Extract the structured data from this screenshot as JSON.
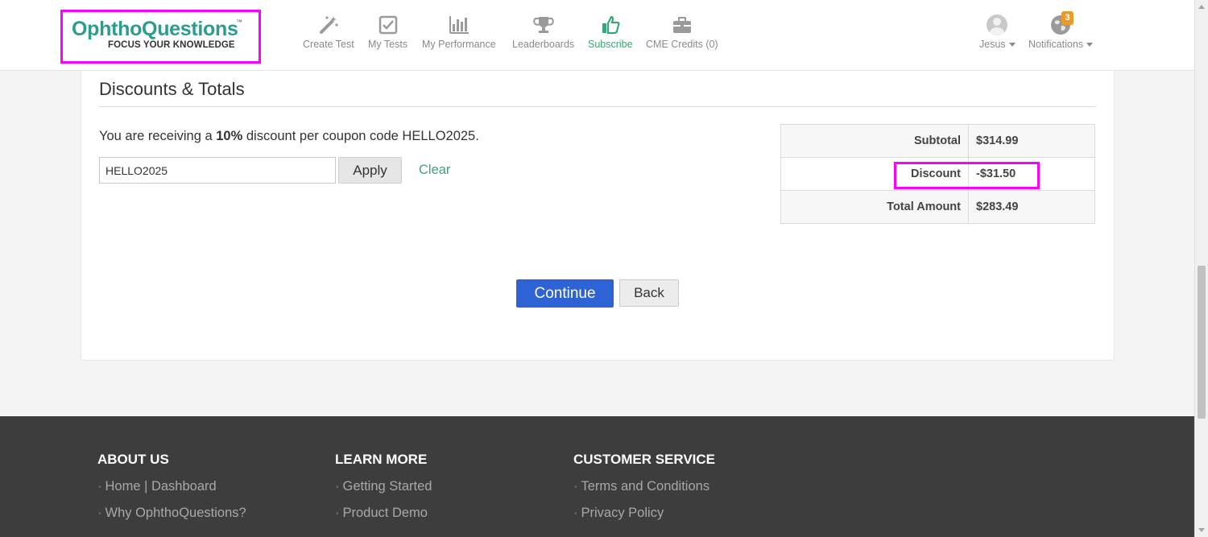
{
  "header": {
    "logo_text": "OphthoQuestions",
    "logo_tm": "™",
    "logo_tagline": "FOCUS YOUR KNOWLEDGE",
    "nav": [
      {
        "label": "Create Test",
        "icon": "magic-wand-icon"
      },
      {
        "label": "My Tests",
        "icon": "checkbox-icon"
      },
      {
        "label": "My Performance",
        "icon": "bar-chart-icon"
      },
      {
        "label": "Leaderboards",
        "icon": "trophy-icon"
      },
      {
        "label": "Subscribe",
        "icon": "thumbs-up-icon",
        "active": true
      },
      {
        "label": "CME Credits (0)",
        "icon": "briefcase-icon"
      }
    ],
    "user": {
      "name": "Jesus",
      "icon": "avatar-icon"
    },
    "notifications": {
      "label": "Notifications",
      "count": "3",
      "icon": "globe-icon"
    }
  },
  "colors": {
    "accent_green": "#3aa57a",
    "primary_blue": "#2e63d6",
    "highlight_magenta": "#ff00ff",
    "badge_orange": "#e89b2c",
    "footer_bg": "#3d3d3d"
  },
  "main": {
    "section_title": "Discounts & Totals",
    "discount_msg_prefix": "You are receiving a ",
    "discount_percent": "10%",
    "discount_msg_suffix": " discount per coupon code HELLO2025.",
    "coupon_value": "HELLO2025",
    "apply_label": "Apply",
    "clear_label": "Clear",
    "totals": [
      {
        "label": "Subtotal",
        "value": "$314.99"
      },
      {
        "label": "Discount",
        "value": "-$31.50"
      },
      {
        "label": "Total Amount",
        "value": "$283.49"
      }
    ],
    "continue_label": "Continue",
    "back_label": "Back"
  },
  "footer": {
    "columns": [
      {
        "heading": "ABOUT US",
        "links": [
          "Home | Dashboard",
          "Why OphthoQuestions?"
        ]
      },
      {
        "heading": "LEARN MORE",
        "links": [
          "Getting Started",
          "Product Demo"
        ]
      },
      {
        "heading": "CUSTOMER SERVICE",
        "links": [
          "Terms and Conditions",
          "Privacy Policy"
        ]
      }
    ],
    "bullet": "·"
  }
}
